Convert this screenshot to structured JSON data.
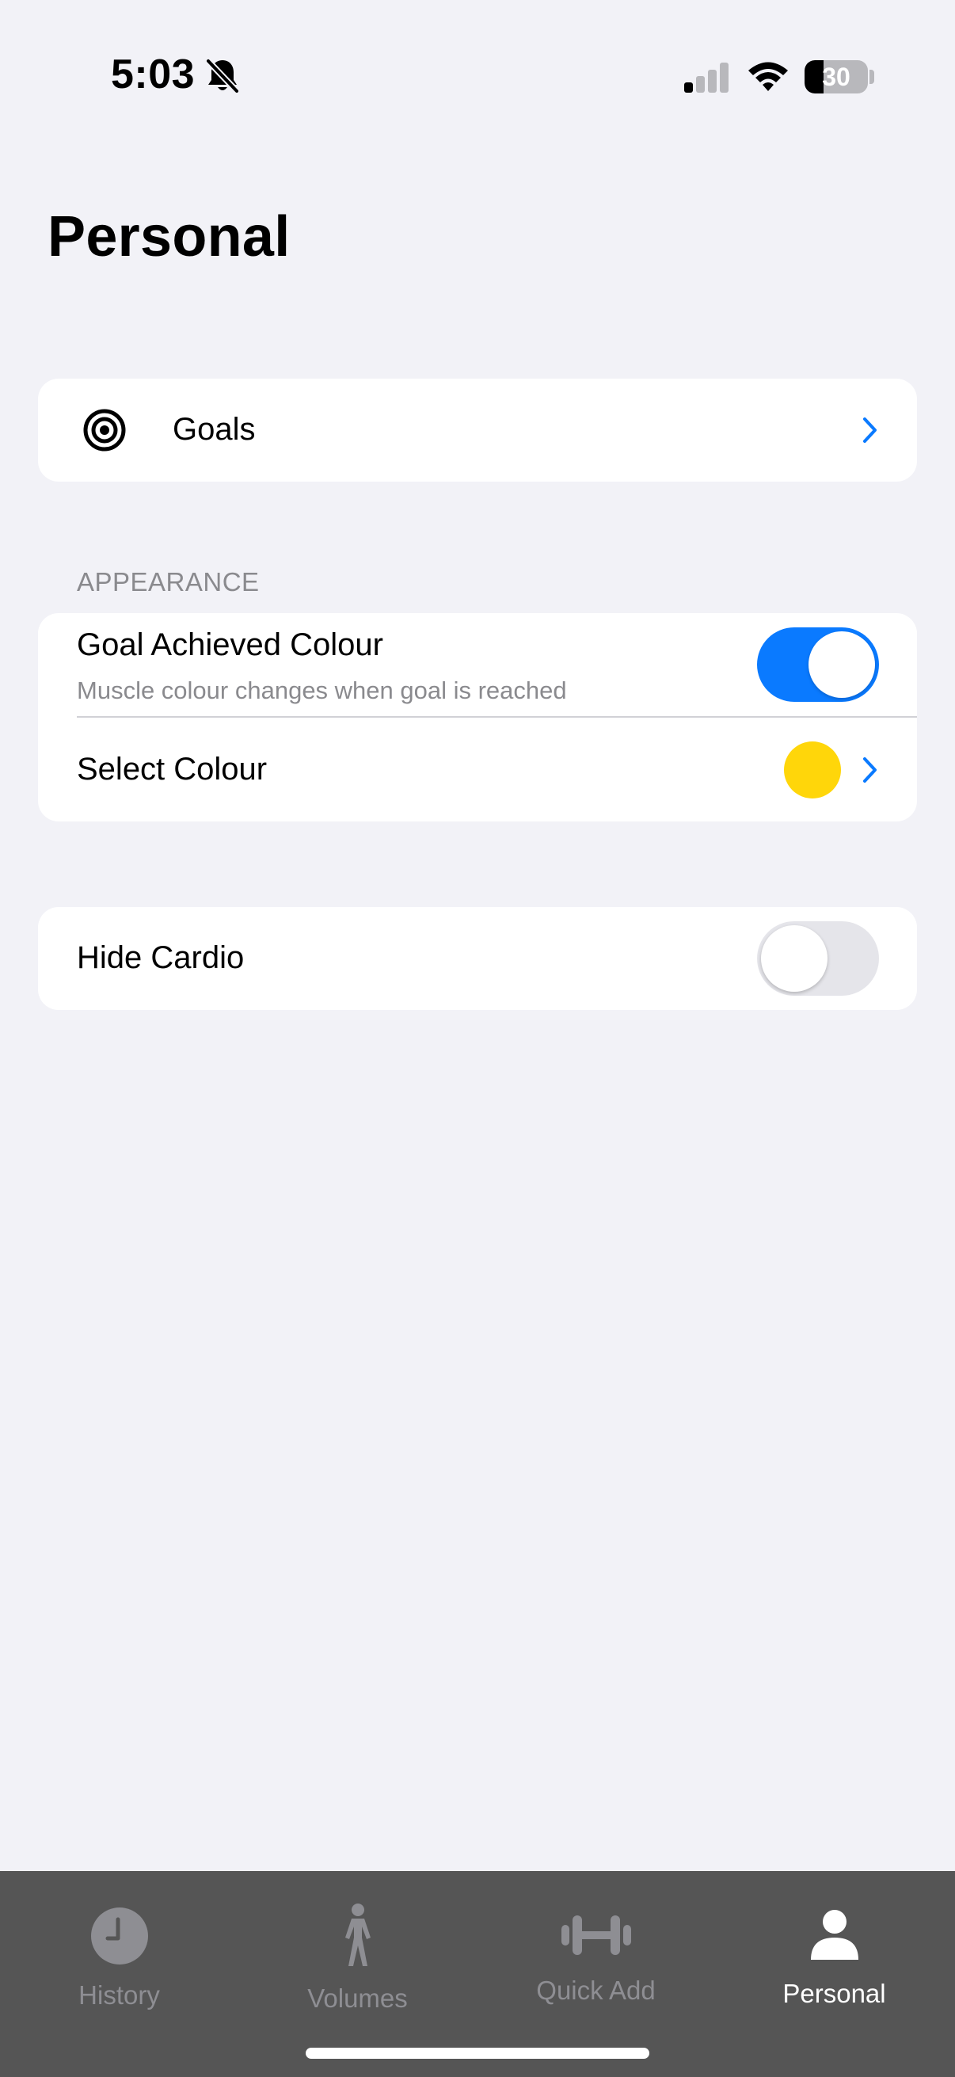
{
  "status_bar": {
    "time": "5:03",
    "battery_level": "30",
    "battery_percent": 30,
    "silent_icon": "bell-slash-icon",
    "signal_icon": "cellular-signal-icon",
    "wifi_icon": "wifi-icon"
  },
  "page": {
    "title": "Personal"
  },
  "goals_row": {
    "icon": "target-icon",
    "label": "Goals",
    "chevron": "chevron-right-icon"
  },
  "appearance": {
    "header": "APPEARANCE",
    "goal_achieved": {
      "label": "Goal Achieved Colour",
      "subtitle": "Muscle colour changes when goal is reached",
      "enabled": true
    },
    "select_colour": {
      "label": "Select Colour",
      "swatch_color": "#FFD60A",
      "chevron": "chevron-right-icon"
    }
  },
  "cardio": {
    "label": "Hide Cardio",
    "enabled": false
  },
  "tab_bar": {
    "tabs": [
      {
        "label": "History",
        "icon": "clock-icon",
        "selected": false
      },
      {
        "label": "Volumes",
        "icon": "figure-walk-icon",
        "selected": false
      },
      {
        "label": "Quick Add",
        "icon": "dumbbell-icon",
        "selected": false
      },
      {
        "label": "Personal",
        "icon": "person-icon",
        "selected": true
      }
    ]
  },
  "colors": {
    "accent": "#0A7AFF",
    "background": "#F2F2F7",
    "tab_bar_background": "#555555",
    "tab_inactive": "#8E8E93",
    "tab_active": "#FFFFFF"
  }
}
